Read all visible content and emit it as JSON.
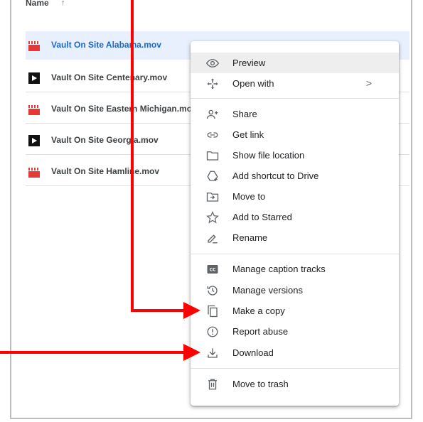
{
  "list": {
    "header": {
      "name_label": "Name",
      "sort_indicator": "↑"
    },
    "files": [
      {
        "name": "Vault On Site Alabama.mov",
        "icon": "red-clapperboard-icon",
        "selected": true
      },
      {
        "name": "Vault On Site Centenary.mov",
        "icon": "black-play-icon",
        "selected": false
      },
      {
        "name": "Vault On Site Eastern Michigan.mov",
        "icon": "red-clapperboard-icon",
        "selected": false
      },
      {
        "name": "Vault On Site Georgia.mov",
        "icon": "black-play-icon",
        "selected": false
      },
      {
        "name": "Vault On Site Hamline.mov",
        "icon": "red-clapperboard-icon",
        "selected": false
      }
    ]
  },
  "context_menu": {
    "items": [
      {
        "label": "Preview",
        "icon": "eye-icon",
        "highlighted": true
      },
      {
        "label": "Open with",
        "icon": "open-with-icon",
        "submenu_arrow": ">"
      },
      {
        "label": "Share",
        "icon": "person-add-icon"
      },
      {
        "label": "Get link",
        "icon": "link-icon"
      },
      {
        "label": "Show file location",
        "icon": "folder-icon"
      },
      {
        "label": "Add shortcut to Drive",
        "icon": "add-shortcut-icon"
      },
      {
        "label": "Move to",
        "icon": "move-to-icon"
      },
      {
        "label": "Add to Starred",
        "icon": "star-icon"
      },
      {
        "label": "Rename",
        "icon": "pencil-icon"
      },
      {
        "label": "Manage caption tracks",
        "icon": "closed-caption-icon"
      },
      {
        "label": "Manage versions",
        "icon": "history-icon"
      },
      {
        "label": "Make a copy",
        "icon": "copy-icon"
      },
      {
        "label": "Report abuse",
        "icon": "report-icon"
      },
      {
        "label": "Download",
        "icon": "download-icon"
      },
      {
        "label": "Move to trash",
        "icon": "trash-icon"
      }
    ]
  },
  "annotation_color": "#ff0000"
}
